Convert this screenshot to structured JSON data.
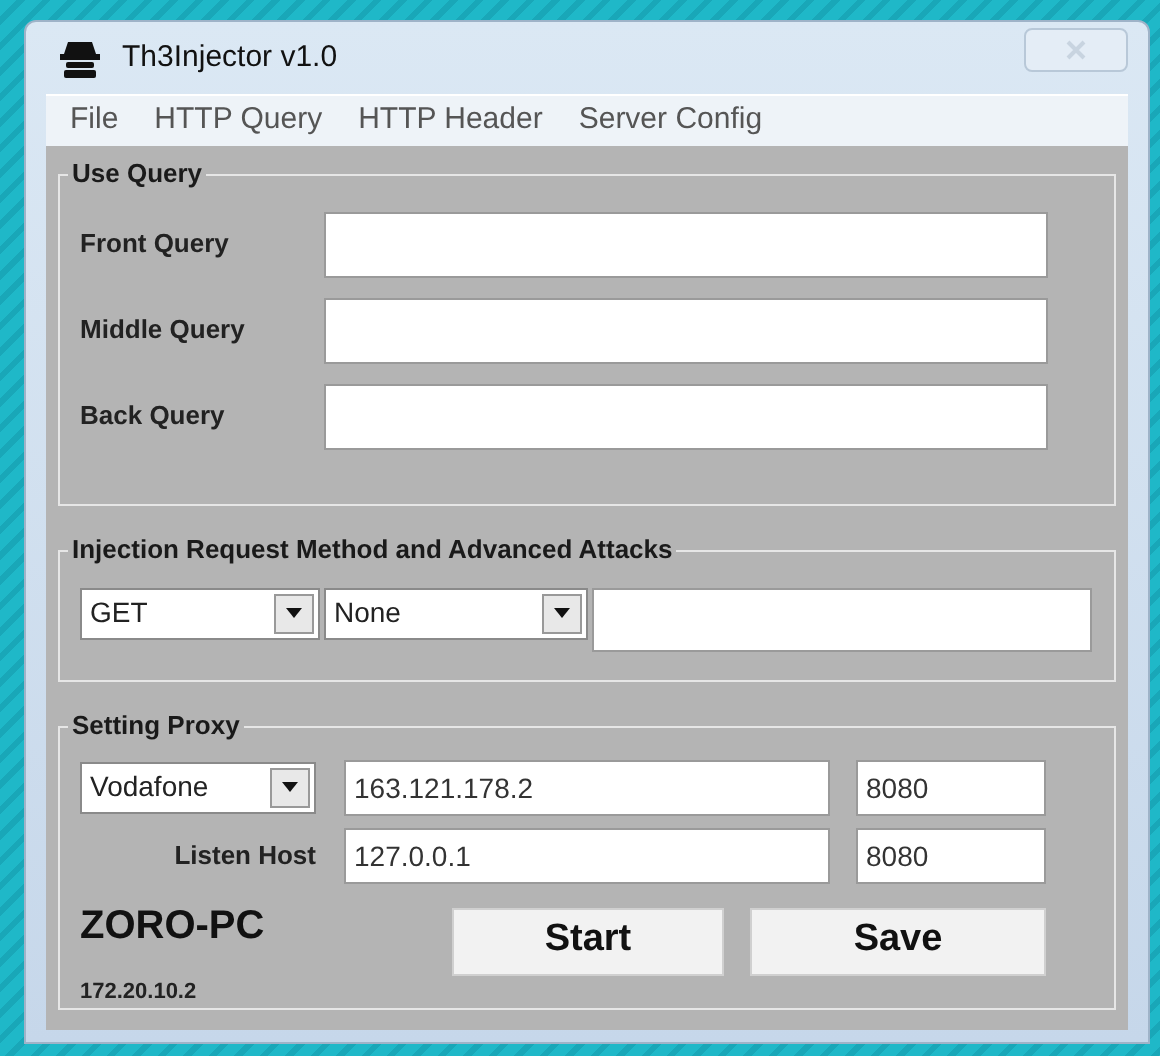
{
  "window": {
    "title": "Th3Injector v1.0"
  },
  "menu": [
    "File",
    "HTTP Query",
    "HTTP Header",
    "Server Config"
  ],
  "use_query": {
    "title": "Use Query",
    "fields": [
      {
        "label": "Front Query"
      },
      {
        "label": "Middle Query"
      },
      {
        "label": "Back Query"
      }
    ]
  },
  "injection": {
    "title": "Injection Request Method and Advanced Attacks",
    "method": "GET",
    "attack": "None"
  },
  "proxy": {
    "title": "Setting Proxy",
    "provider": "Vodafone",
    "proxy_host": "163.121.178.2",
    "proxy_port": "8080",
    "listen_label": "Listen Host",
    "listen_host": "127.0.0.1",
    "listen_port": "8080",
    "pc_name": "ZORO-PC",
    "pc_ip": "172.20.10.2"
  },
  "buttons": [
    "Start",
    "Save"
  ]
}
